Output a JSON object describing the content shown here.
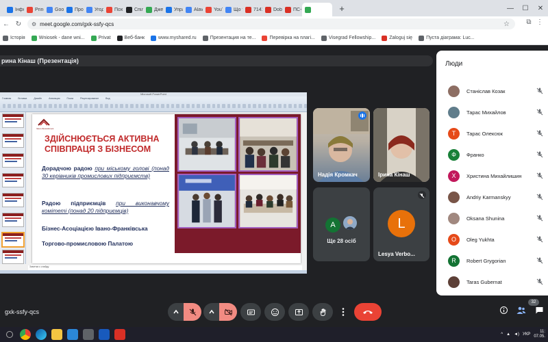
{
  "browser": {
    "tabs": [
      {
        "label": "Інфор",
        "color": "#1a73e8"
      },
      {
        "label": "Princ",
        "color": "#ea4335"
      },
      {
        "label": "Goog",
        "color": "#4285f4"
      },
      {
        "label": "Про с",
        "color": "#1a73e8"
      },
      {
        "label": "Угодя",
        "color": "#4285f4"
      },
      {
        "label": "Пох Е",
        "color": "#ea4335"
      },
      {
        "label": "Спілк",
        "color": "#202124"
      },
      {
        "label": "Джер",
        "color": "#34a853"
      },
      {
        "label": "Упра",
        "color": "#1a73e8"
      },
      {
        "label": "Alavi",
        "color": "#4285f4"
      },
      {
        "label": "YouTu",
        "color": "#ea4335"
      },
      {
        "label": "Що та",
        "color": "#4285f4"
      },
      {
        "label": "7141(",
        "color": "#d93025"
      },
      {
        "label": "Dobr",
        "color": "#d93025"
      },
      {
        "label": "ПС-Р",
        "color": "#d93025"
      },
      {
        "label": "",
        "color": "#34a853",
        "active": true
      }
    ],
    "new_tab": "+",
    "url": "meet.google.com/gxk-ssfy-qcs",
    "bookmarks": [
      {
        "label": "Історія",
        "color": "#5f6368"
      },
      {
        "label": "Wniosek - dane wni...",
        "color": "#34a853"
      },
      {
        "label": "Privat",
        "color": "#34a853"
      },
      {
        "label": "Веб-банк",
        "color": "#202124"
      },
      {
        "label": "www.myshared.ru",
        "color": "#1a73e8"
      },
      {
        "label": "Презентация на те...",
        "color": "#5f6368"
      },
      {
        "label": "Перевірка на плагі...",
        "color": "#ea4335"
      },
      {
        "label": "Visegrad Fellowship...",
        "color": "#5f6368"
      },
      {
        "label": "Zaloguj się",
        "color": "#d93025"
      },
      {
        "label": "Пуста діаграма: Luc...",
        "color": "#5f6368"
      }
    ]
  },
  "meet": {
    "presenter_title": "рина Кінаш (Презентація)",
    "meeting_code": "gxk-ssfy-qcs",
    "participants_count": "32",
    "slide": {
      "logo_text": "Івано-Франківська",
      "title": "Здійснюється активна співпраця з бізнесом",
      "para1_bold": "Дорадчою радою",
      "para1_rest": "при міському голові (понад 30 керівників промислових підприємств)",
      "para2_bold": "Радою підприємців",
      "para2_rest": "при виконавчому комітеті (понад 20 підприємців)",
      "para3": "Бізнес-Асоціацією Івано-Франківська",
      "para4": "Торгово-промисловою Палатою",
      "notes": "Заметки к слайду"
    },
    "tiles": {
      "nadia": "Надія Кромкач",
      "iryna": "Ірина Кінаш",
      "more_label": "Ще 28 осіб",
      "more_avatar_letter": "A",
      "lesya": "Lesya Verbo...",
      "lesya_letter": "L"
    },
    "people_panel": {
      "title": "Люди",
      "people": [
        {
          "name": "Станіслав Козак",
          "letter": "",
          "color": "#8d6e63"
        },
        {
          "name": "Тарас Михайлов",
          "letter": "",
          "color": "#607d8b"
        },
        {
          "name": "Тарас Олексюк",
          "letter": "Т",
          "color": "#e64a19"
        },
        {
          "name": "Франко",
          "letter": "Ф",
          "color": "#188038"
        },
        {
          "name": "Христина Михайлишин",
          "letter": "Х",
          "color": "#c2185b"
        },
        {
          "name": "Andriy Karmanskyy",
          "letter": "",
          "color": "#795548"
        },
        {
          "name": "Oksana Shunina",
          "letter": "",
          "color": "#a1887f"
        },
        {
          "name": "Oleg Yukhta",
          "letter": "O",
          "color": "#e64a19"
        },
        {
          "name": "Robert Grygorian",
          "letter": "R",
          "color": "#137333"
        },
        {
          "name": "Taras Gubernat",
          "letter": "",
          "color": "#5d4037"
        }
      ]
    }
  },
  "taskbar": {
    "lang": "УКР",
    "time": "11:",
    "date": "07.05."
  }
}
